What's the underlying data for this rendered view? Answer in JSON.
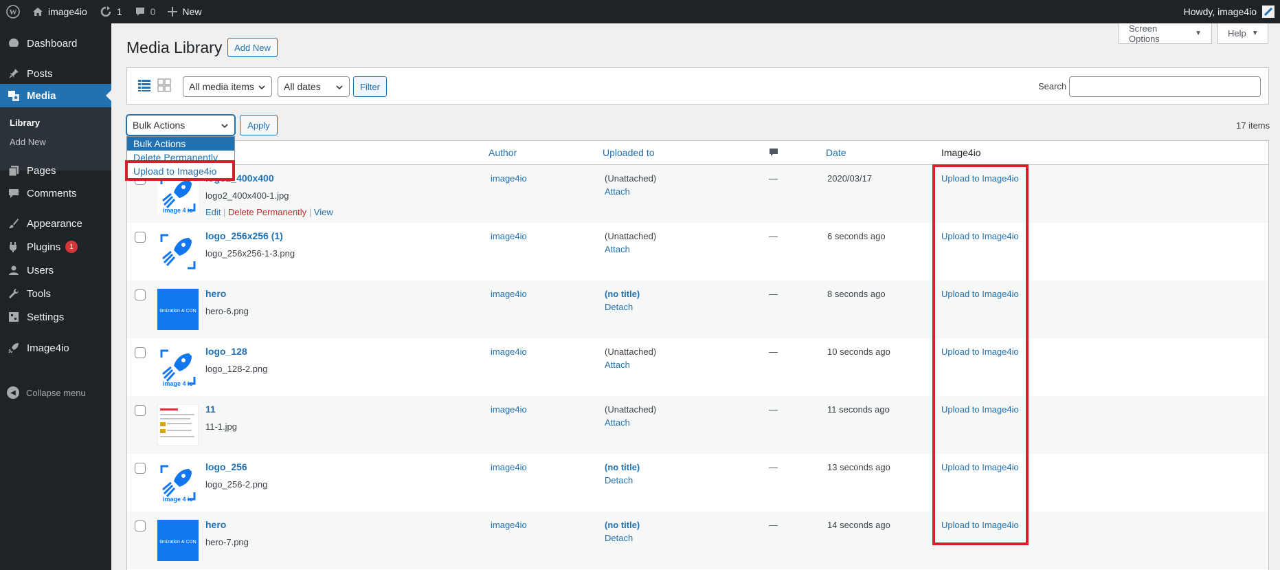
{
  "admin_bar": {
    "site_name": "image4io",
    "updates_count": "1",
    "comments_count": "0",
    "new_label": "New",
    "howdy": "Howdy, image4io"
  },
  "sidebar": {
    "items": [
      {
        "label": "Dashboard",
        "icon": "dashboard-icon"
      },
      {
        "label": "Posts",
        "icon": "pushpin-icon"
      },
      {
        "label": "Media",
        "icon": "media-icon"
      },
      {
        "label": "Pages",
        "icon": "pages-icon"
      },
      {
        "label": "Comments",
        "icon": "comments-icon"
      },
      {
        "label": "Appearance",
        "icon": "brush-icon"
      },
      {
        "label": "Plugins",
        "icon": "plugin-icon",
        "badge": "1"
      },
      {
        "label": "Users",
        "icon": "users-icon"
      },
      {
        "label": "Tools",
        "icon": "wrench-icon"
      },
      {
        "label": "Settings",
        "icon": "settings-icon"
      },
      {
        "label": "Image4io",
        "icon": "rocket-icon"
      }
    ],
    "submenu": [
      "Library",
      "Add New"
    ],
    "collapse_label": "Collapse menu"
  },
  "screen_options_label": "Screen Options",
  "help_label": "Help",
  "page_title": "Media Library",
  "add_new_label": "Add New",
  "filter": {
    "media_select": "All media items",
    "date_select": "All dates",
    "filter_button": "Filter",
    "search_label": "Search",
    "search_value": ""
  },
  "bulk": {
    "selected": "Bulk Actions",
    "apply_label": "Apply",
    "options": [
      "Bulk Actions",
      "Delete Permanently",
      "Upload to Image4io"
    ],
    "items_count": "17 items"
  },
  "columns": {
    "author": "Author",
    "uploaded_to": "Uploaded to",
    "date": "Date",
    "image4io": "Image4io"
  },
  "row_actions": {
    "edit": "Edit",
    "delete": "Delete Permanently",
    "view": "View"
  },
  "rows": [
    {
      "title": "logo2_400x400",
      "file": "logo2_400x400-1.jpg",
      "author": "image4io",
      "uploaded": "(Unattached)",
      "action": "Attach",
      "comments": "—",
      "date": "2020/03/17",
      "upload": "Upload to Image4io",
      "thumb": "logo"
    },
    {
      "title": "logo_256x256 (1)",
      "file": "logo_256x256-1-3.png",
      "author": "image4io",
      "uploaded": "(Unattached)",
      "action": "Attach",
      "comments": "—",
      "date": "6 seconds ago",
      "upload": "Upload to Image4io",
      "thumb": "logo-plain"
    },
    {
      "title": "hero",
      "file": "hero-6.png",
      "author": "image4io",
      "uploaded": "(no title)",
      "action": "Detach",
      "comments": "—",
      "date": "8 seconds ago",
      "upload": "Upload to Image4io",
      "thumb": "hero"
    },
    {
      "title": "logo_128",
      "file": "logo_128-2.png",
      "author": "image4io",
      "uploaded": "(Unattached)",
      "action": "Attach",
      "comments": "—",
      "date": "10 seconds ago",
      "upload": "Upload to Image4io",
      "thumb": "logo"
    },
    {
      "title": "11",
      "file": "11-1.jpg",
      "author": "image4io",
      "uploaded": "(Unattached)",
      "action": "Attach",
      "comments": "—",
      "date": "11 seconds ago",
      "upload": "Upload to Image4io",
      "thumb": "screenshot"
    },
    {
      "title": "logo_256",
      "file": "logo_256-2.png",
      "author": "image4io",
      "uploaded": "(no title)",
      "action": "Detach",
      "comments": "—",
      "date": "13 seconds ago",
      "upload": "Upload to Image4io",
      "thumb": "logo"
    },
    {
      "title": "hero",
      "file": "hero-7.png",
      "author": "image4io",
      "uploaded": "(no title)",
      "action": "Detach",
      "comments": "—",
      "date": "14 seconds ago",
      "upload": "Upload to Image4io",
      "thumb": "hero"
    }
  ],
  "thumb_texts": {
    "logo": "image 4 io",
    "hero": "timization & CDN"
  },
  "colors": {
    "accent": "#2271b1",
    "highlight": "#d22128",
    "adminbar": "#1d2327",
    "logo_blue": "#1177ee"
  }
}
